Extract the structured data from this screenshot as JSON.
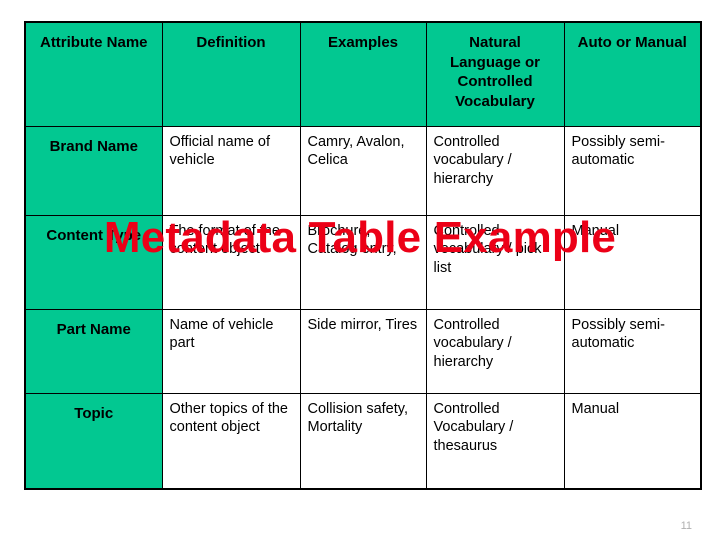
{
  "slide": {
    "overlay_title": "Metadata Table Example",
    "overlay_color": "#EC0017",
    "header_fill_color": "#02C891",
    "page_number": "11"
  },
  "table": {
    "columns": [
      "Attribute Name",
      "Definition",
      "Examples",
      "Natural Language or Controlled Vocabulary",
      "Auto or Manual"
    ],
    "rows": [
      {
        "attribute_name": "Brand Name",
        "definition": "Official name of vehicle",
        "examples": "Camry, Avalon, Celica",
        "vocabulary": "Controlled vocabulary / hierarchy",
        "auto_or_manual": "Possibly semi-automatic"
      },
      {
        "attribute_name": "Content Type",
        "definition": "The format of the content object",
        "examples": "Brochure, Catalog entry,",
        "vocabulary": "Controlled vocabulary / pick list",
        "auto_or_manual": "Manual"
      },
      {
        "attribute_name": "Part Name",
        "definition": "Name of vehicle part",
        "examples": "Side mirror, Tires",
        "vocabulary": "Controlled vocabulary / hierarchy",
        "auto_or_manual": "Possibly semi-automatic"
      },
      {
        "attribute_name": "Topic",
        "definition": "Other topics of the content object",
        "examples": "Collision safety, Mortality",
        "vocabulary": "Controlled Vocabulary / thesaurus",
        "auto_or_manual": "Manual"
      }
    ]
  }
}
